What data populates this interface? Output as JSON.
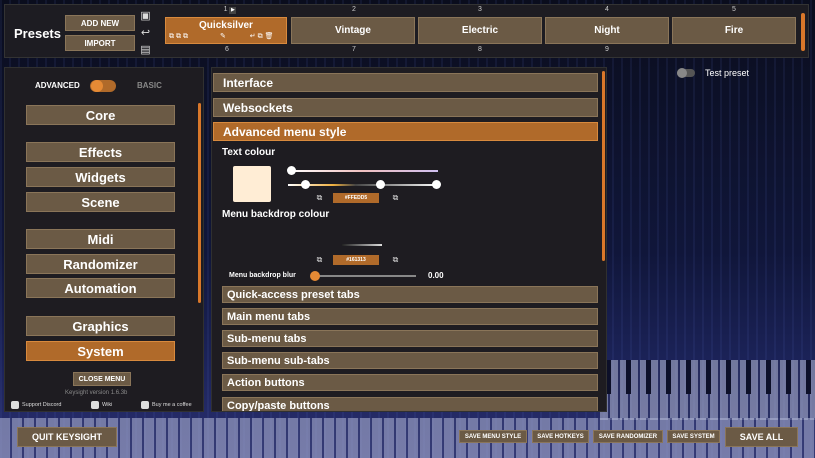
{
  "presets": {
    "title": "Presets",
    "add_new": "ADD NEW",
    "import": "IMPORT",
    "slots": [
      {
        "num": "1",
        "name": "Quicksilver",
        "active": true
      },
      {
        "num": "2",
        "name": "Vintage"
      },
      {
        "num": "3",
        "name": "Electric"
      },
      {
        "num": "4",
        "name": "Night"
      },
      {
        "num": "5",
        "name": "Fire"
      }
    ],
    "next_row_nums": [
      "6",
      "7",
      "8",
      "9"
    ],
    "play_icon": "play-icon"
  },
  "test_preset": {
    "label": "Test preset",
    "on": false
  },
  "mode": {
    "advanced": "ADVANCED",
    "basic": "BASIC"
  },
  "nav": [
    {
      "label": "Core"
    },
    {
      "label": "Effects"
    },
    {
      "label": "Widgets"
    },
    {
      "label": "Scene"
    },
    {
      "label": "Midi"
    },
    {
      "label": "Randomizer"
    },
    {
      "label": "Automation"
    },
    {
      "label": "Graphics"
    },
    {
      "label": "System",
      "active": true
    }
  ],
  "close_menu": "CLOSE MENU",
  "version": "Keysight version 1.6.3b",
  "links": {
    "discord": "Support Discord",
    "wiki": "Wiki",
    "coffee": "Buy me a coffee"
  },
  "quit": "QUIT KEYSIGHT",
  "main": {
    "sections": [
      "Interface",
      "Websockets",
      "Advanced menu style"
    ],
    "text_colour": {
      "label": "Text colour",
      "hex": "#FFEDD5",
      "color": "#ffedd5"
    },
    "menu_backdrop": {
      "label": "Menu backdrop colour",
      "hex": "#161313",
      "color": "#161313"
    },
    "blur": {
      "label": "Menu backdrop blur",
      "value": "0.00"
    },
    "sub_sections": [
      "Quick-access preset tabs",
      "Main menu tabs",
      "Sub-menu tabs",
      "Sub-menu sub-tabs",
      "Action buttons",
      "Copy/paste buttons"
    ]
  },
  "save_buttons": {
    "menu_style": "SAVE MENU STYLE",
    "hotkeys": "SAVE HOTKEYS",
    "randomizer": "SAVE RANDOMIZER",
    "system": "SAVE SYSTEM",
    "all": "SAVE ALL"
  },
  "colors": {
    "accent": "#b06a2a",
    "button": "#6b5a45",
    "panel": "#1e1c21"
  }
}
